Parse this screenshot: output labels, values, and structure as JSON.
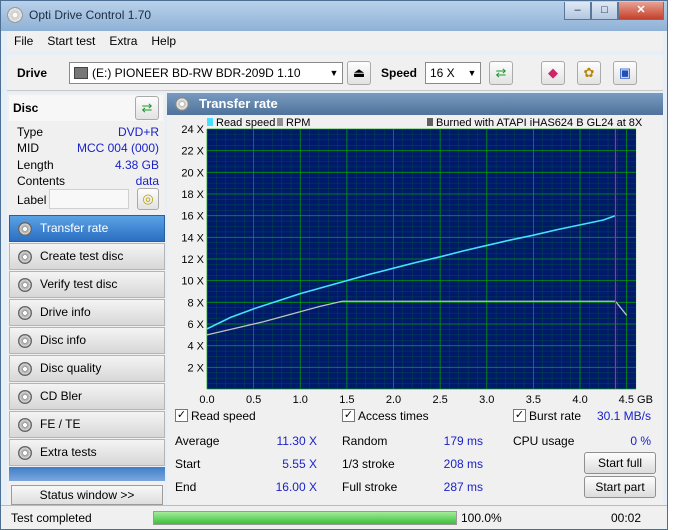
{
  "window": {
    "title": "Opti Drive Control 1.70",
    "controls": [
      "–",
      "□",
      "✕"
    ]
  },
  "menu": [
    "File",
    "Start test",
    "Extra",
    "Help"
  ],
  "toolbar": {
    "drive_label": "Drive",
    "drive_value": "(E:)  PIONEER BD-RW   BDR-209D 1.10",
    "speed_label": "Speed",
    "speed_value": "16 X"
  },
  "disc": {
    "header": "Disc",
    "fields": [
      {
        "key": "Type",
        "value": "DVD+R"
      },
      {
        "key": "MID",
        "value": "MCC 004 (000)"
      },
      {
        "key": "Length",
        "value": "4.38 GB"
      },
      {
        "key": "Contents",
        "value": "data"
      }
    ],
    "label_key": "Label"
  },
  "nav": [
    {
      "label": "Transfer rate",
      "active": true
    },
    {
      "label": "Create test disc",
      "active": false
    },
    {
      "label": "Verify test disc",
      "active": false
    },
    {
      "label": "Drive info",
      "active": false
    },
    {
      "label": "Disc info",
      "active": false
    },
    {
      "label": "Disc quality",
      "active": false
    },
    {
      "label": "CD Bler",
      "active": false
    },
    {
      "label": "FE / TE",
      "active": false
    },
    {
      "label": "Extra tests",
      "active": false
    }
  ],
  "status_window_button": "Status window >>",
  "main": {
    "title": "Transfer rate"
  },
  "chart_data": {
    "type": "line",
    "legend": [
      "Read speed",
      "RPM"
    ],
    "burned_note": "Burned with ATAPI iHAS624   B GL24 at 8X",
    "y_ticks": [
      "24 X",
      "22 X",
      "20 X",
      "18 X",
      "16 X",
      "14 X",
      "12 X",
      "10 X",
      "8 X",
      "6 X",
      "4 X",
      "2 X"
    ],
    "x_ticks": [
      "0.0",
      "0.5",
      "1.0",
      "1.5",
      "2.0",
      "2.5",
      "3.0",
      "3.5",
      "4.0",
      "4.5 GB"
    ],
    "xlim": [
      0,
      4.6
    ],
    "ylim": [
      0,
      24
    ],
    "colors": {
      "background": "#001a6b",
      "grid": "#00a800",
      "read": "#45e0ff",
      "rpm": "#c0c0c0",
      "end_marker": "#d0206a"
    },
    "series": [
      {
        "name": "Read speed",
        "x": [
          0,
          0.25,
          0.5,
          0.75,
          1.0,
          1.25,
          1.5,
          1.75,
          2.0,
          2.25,
          2.5,
          2.75,
          3.0,
          3.25,
          3.5,
          3.75,
          4.0,
          4.25,
          4.38
        ],
        "values": [
          5.55,
          6.6,
          7.4,
          8.1,
          8.8,
          9.4,
          10.0,
          10.6,
          11.15,
          11.7,
          12.2,
          12.75,
          13.25,
          13.75,
          14.2,
          14.7,
          15.15,
          15.6,
          16.0
        ]
      },
      {
        "name": "RPM",
        "x": [
          0,
          0.3,
          0.6,
          0.9,
          1.2,
          1.45,
          1.5,
          2.0,
          2.5,
          3.0,
          3.5,
          4.0,
          4.38,
          4.5
        ],
        "values": [
          5.0,
          5.6,
          6.2,
          6.9,
          7.6,
          8.1,
          8.1,
          8.1,
          8.1,
          8.1,
          8.1,
          8.1,
          8.1,
          6.8
        ]
      }
    ],
    "end_marker_x": 4.38
  },
  "stats": {
    "read_speed_label": "Read speed",
    "access_times_label": "Access times",
    "burst_rate_label": "Burst rate",
    "burst_rate_value": "30.1 MB/s",
    "average_label": "Average",
    "average_value": "11.30 X",
    "start_label": "Start",
    "start_value": "5.55 X",
    "end_label": "End",
    "end_value": "16.00 X",
    "random_label": "Random",
    "random_value": "179 ms",
    "one_third_label": "1/3 stroke",
    "one_third_value": "208 ms",
    "full_stroke_label": "Full stroke",
    "full_stroke_value": "287 ms",
    "cpu_label": "CPU usage",
    "cpu_value": "0 %",
    "start_full_button": "Start full",
    "start_part_button": "Start part"
  },
  "statusbar": {
    "text": "Test completed",
    "progress_fraction": 1.0,
    "progress_text": "100.0%",
    "time": "00:02"
  }
}
